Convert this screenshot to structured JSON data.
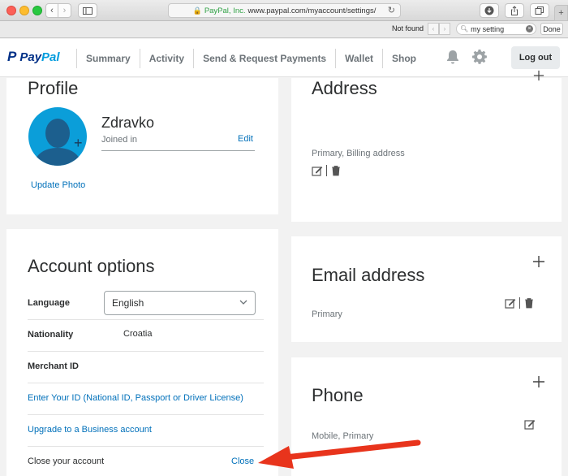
{
  "browser": {
    "url_org": "PayPal, Inc.",
    "url_text": "www.paypal.com/myaccount/settings/",
    "find_status": "Not found",
    "find_query": "my setting",
    "find_done": "Done"
  },
  "header": {
    "nav": [
      "Summary",
      "Activity",
      "Send & Request Payments",
      "Wallet",
      "Shop"
    ],
    "logout": "Log out",
    "logo_word_a": "Pay",
    "logo_word_b": "Pal"
  },
  "profile": {
    "title": "Profile",
    "name": "Zdravko",
    "joined": "Joined in",
    "edit": "Edit",
    "update_photo": "Update Photo"
  },
  "account_options": {
    "title": "Account options",
    "language_label": "Language",
    "language_value": "English",
    "nationality_label": "Nationality",
    "nationality_value": "Croatia",
    "merchant_label": "Merchant ID",
    "enter_id_link": "Enter Your ID (National ID, Passport or Driver License)",
    "upgrade_link": "Upgrade to a Business account",
    "close_label": "Close your account",
    "close_link": "Close"
  },
  "address": {
    "title": "Address",
    "subtitle": "Primary, Billing address"
  },
  "email": {
    "title": "Email address",
    "subtitle": "Primary"
  },
  "phone": {
    "title": "Phone",
    "subtitle": "Mobile, Primary"
  },
  "colors": {
    "paypal_dark": "#003087",
    "paypal_light": "#009cde",
    "link": "#0070ba",
    "arrow": "#e8341c"
  }
}
